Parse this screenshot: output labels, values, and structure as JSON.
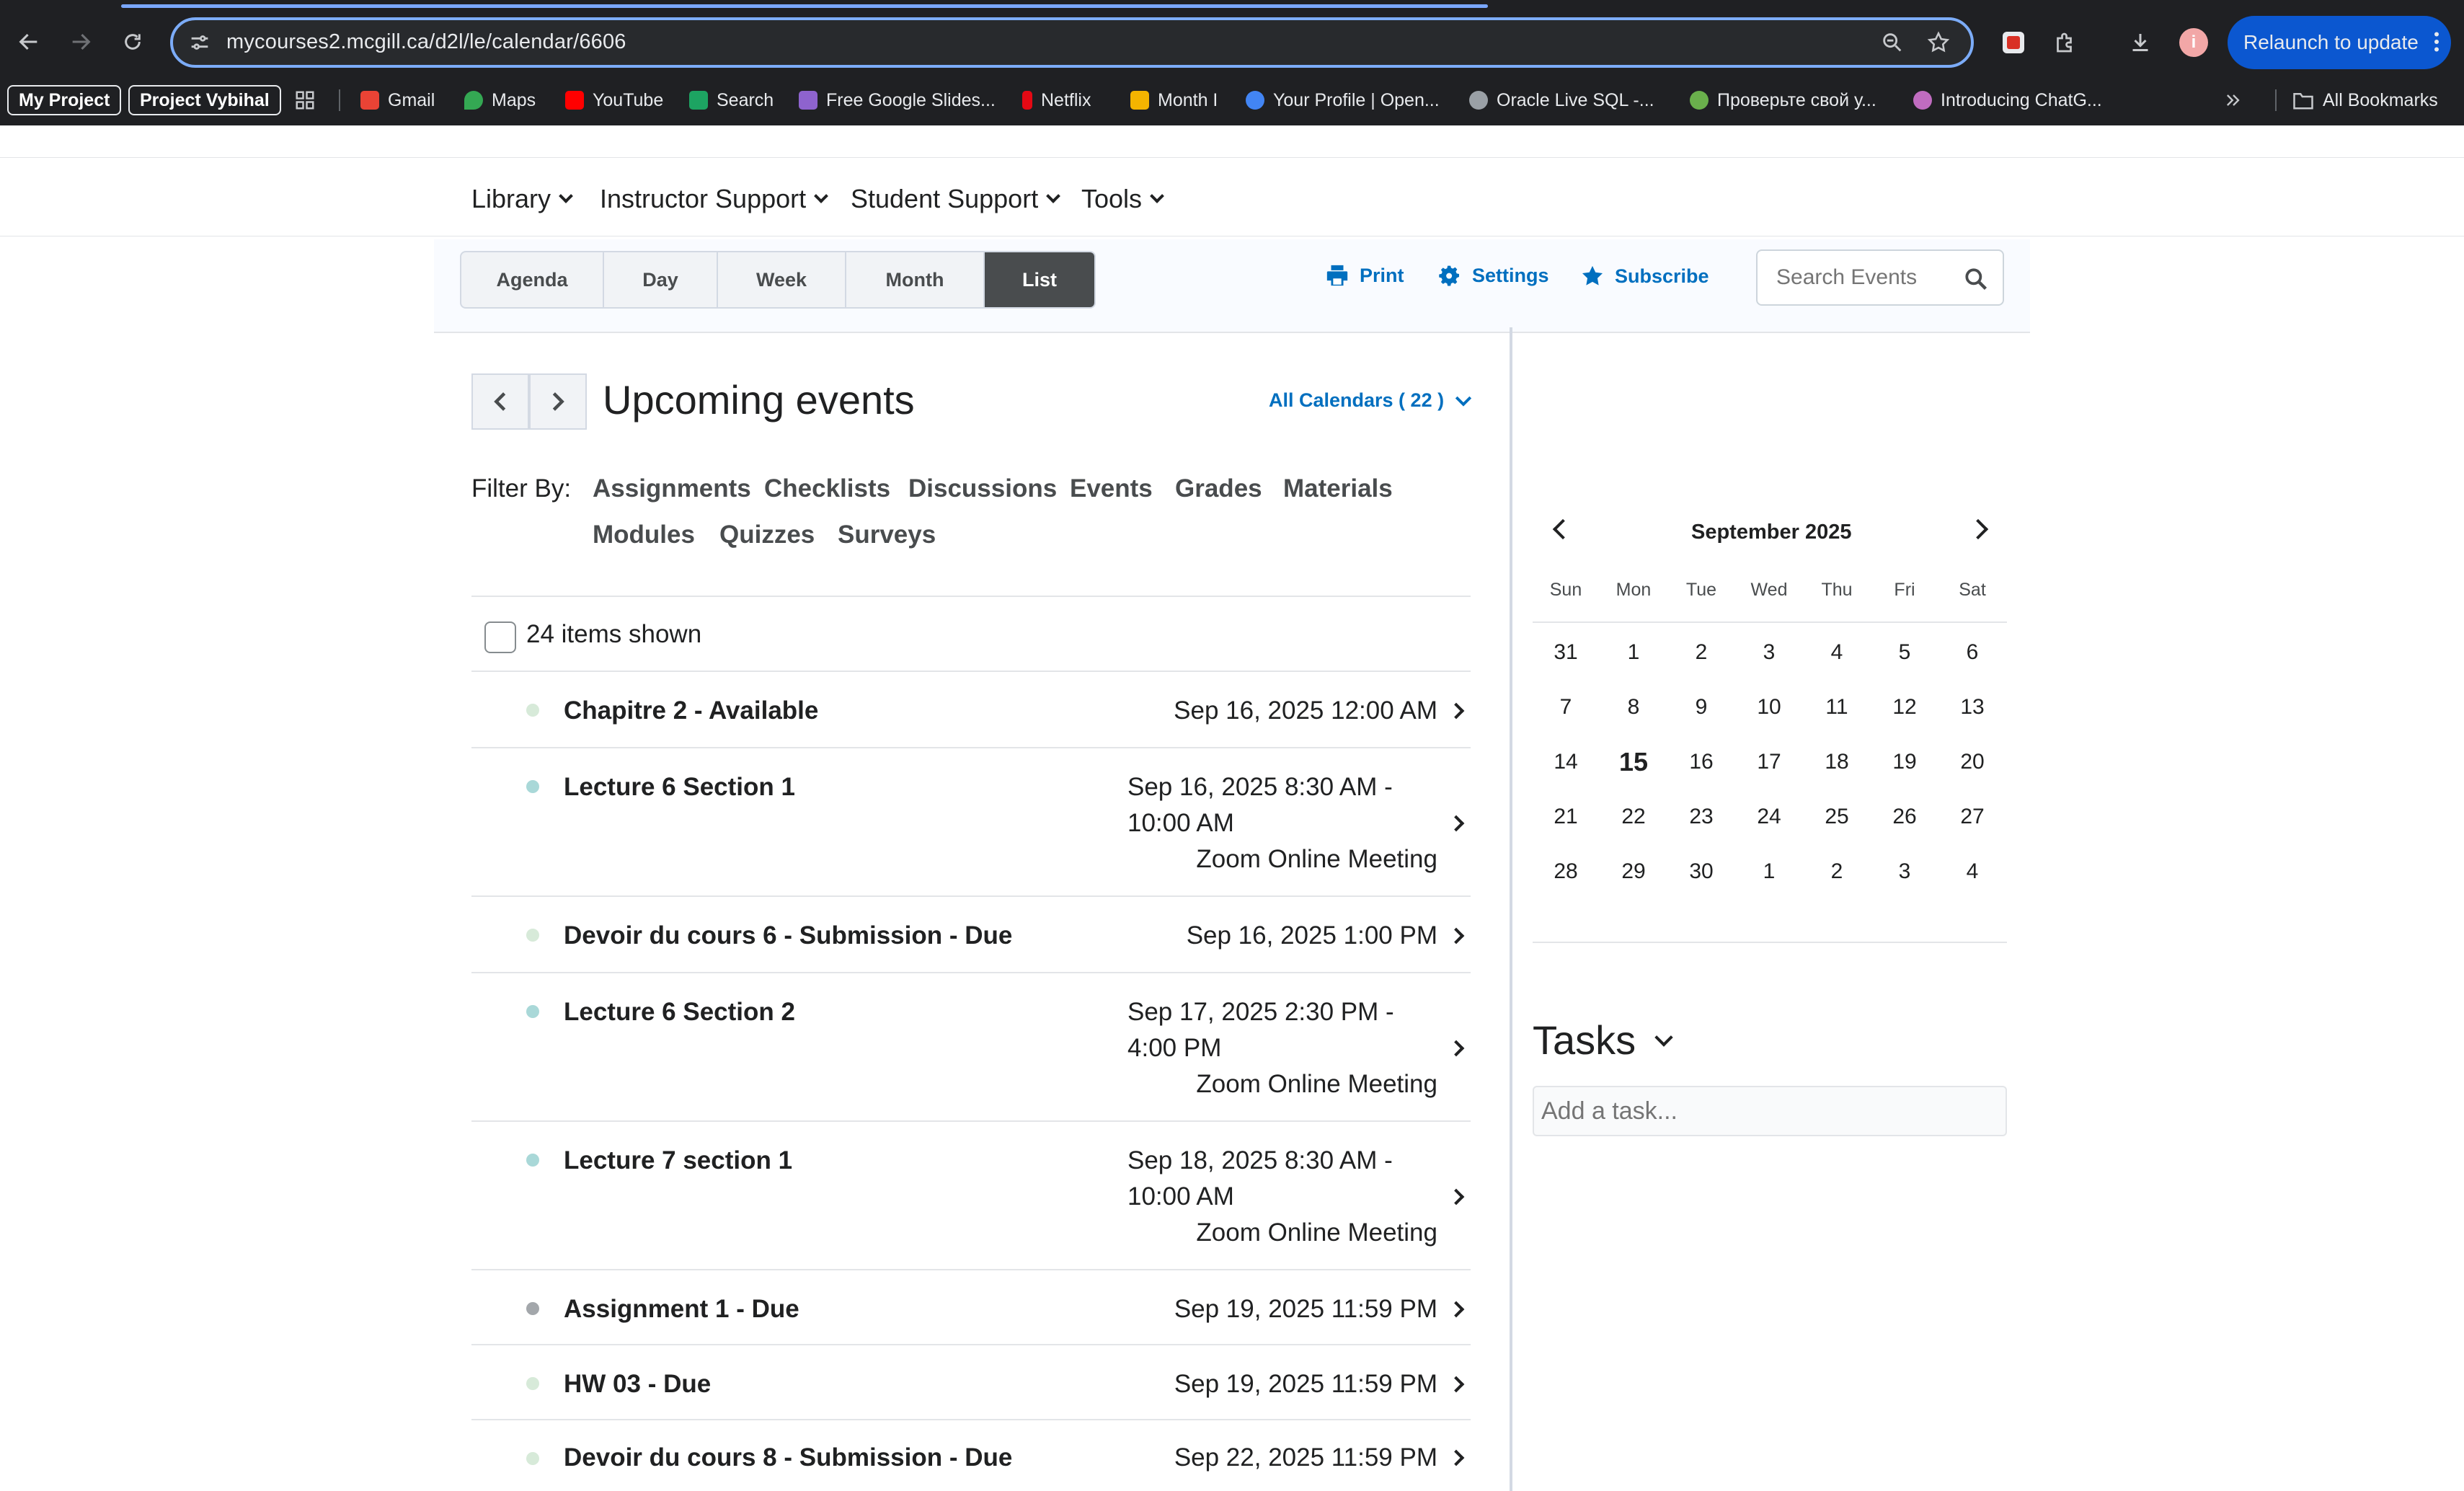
{
  "browser": {
    "url": "mycourses2.mcgill.ca/d2l/le/calendar/6606",
    "relaunch_label": "Relaunch to update",
    "profile_initial": "i",
    "bookmarks": [
      {
        "label": "My Project",
        "style": "pill"
      },
      {
        "label": "Project Vybihal",
        "style": "pill"
      },
      {
        "label": "Gmail",
        "color": "#ea4335"
      },
      {
        "label": "Maps",
        "color": "#34a853"
      },
      {
        "label": "YouTube",
        "color": "#ff0000"
      },
      {
        "label": "Search",
        "color": "#1da462"
      },
      {
        "label": "Free Google Slides...",
        "color": "#8e63ce"
      },
      {
        "label": "Netflix",
        "color": "#e50914"
      },
      {
        "label": "Month I",
        "color": "#f4b400"
      },
      {
        "label": "Your Profile | Open...",
        "color": "#4285f4"
      },
      {
        "label": "Oracle Live SQL -...",
        "color": "#9aa0a6"
      },
      {
        "label": "Проверьте свой у...",
        "color": "#6ab04c"
      },
      {
        "label": "Introducing ChatG...",
        "color": "#c06cc0"
      }
    ],
    "all_bookmarks_label": "All Bookmarks"
  },
  "nav": {
    "items": [
      "Library",
      "Instructor Support",
      "Student Support",
      "Tools"
    ]
  },
  "toolbar": {
    "views": [
      "Agenda",
      "Day",
      "Week",
      "Month",
      "List"
    ],
    "active_view": "List",
    "print_label": "Print",
    "settings_label": "Settings",
    "subscribe_label": "Subscribe",
    "search_placeholder": "Search Events"
  },
  "list": {
    "title": "Upcoming events",
    "calendars_label": "All Calendars ( 22 )",
    "filter_label": "Filter By:",
    "filters": [
      "Assignments",
      "Checklists",
      "Discussions",
      "Events",
      "Grades",
      "Materials",
      "Modules",
      "Quizzes",
      "Surveys"
    ],
    "items_shown": "24 items shown",
    "events": [
      {
        "name": "Chapitre 2 - Available",
        "time": "Sep 16, 2025 12:00 AM",
        "dot": "#d7ead9"
      },
      {
        "name": "Lecture 6 Section 1",
        "time_line1": "Sep 16, 2025 8:30 AM -",
        "time_line2": "10:00 AM",
        "location": "Zoom Online Meeting",
        "dot": "#a9d8d8"
      },
      {
        "name": "Devoir du cours 6 - Submission - Due",
        "time": "Sep 16, 2025 1:00 PM",
        "dot": "#d7ead9"
      },
      {
        "name": "Lecture 6 Section 2",
        "time_line1": "Sep 17, 2025 2:30 PM -",
        "time_line2": "4:00 PM",
        "location": "Zoom Online Meeting",
        "dot": "#a9d8d8"
      },
      {
        "name": "Lecture 7 section 1",
        "time_line1": "Sep 18, 2025 8:30 AM -",
        "time_line2": "10:00 AM",
        "location": "Zoom Online Meeting",
        "dot": "#a9d8d8"
      },
      {
        "name": "Assignment 1 - Due",
        "time": "Sep 19, 2025 11:59 PM",
        "dot": "#a3a7ab"
      },
      {
        "name": "HW 03 - Due",
        "time": "Sep 19, 2025 11:59 PM",
        "dot": "#d7ead9"
      },
      {
        "name": "Devoir du cours 8 - Submission - Due",
        "time": "Sep 22, 2025 11:59 PM",
        "dot": "#d7ead9"
      }
    ]
  },
  "calendar": {
    "month_label": "September 2025",
    "weekdays": [
      "Sun",
      "Mon",
      "Tue",
      "Wed",
      "Thu",
      "Fri",
      "Sat"
    ],
    "weeks": [
      [
        {
          "d": "31"
        },
        {
          "d": "1"
        },
        {
          "d": "2",
          "ev": true
        },
        {
          "d": "3",
          "ev": true
        },
        {
          "d": "4",
          "ev": true
        },
        {
          "d": "5",
          "ev": true
        },
        {
          "d": "6"
        }
      ],
      [
        {
          "d": "7"
        },
        {
          "d": "8",
          "ev": true
        },
        {
          "d": "9",
          "ev": true
        },
        {
          "d": "10",
          "ev": true
        },
        {
          "d": "11",
          "ev": true
        },
        {
          "d": "12",
          "ev": true
        },
        {
          "d": "13"
        }
      ],
      [
        {
          "d": "14"
        },
        {
          "d": "15",
          "ev": true,
          "today": true
        },
        {
          "d": "16",
          "ev": true
        },
        {
          "d": "17",
          "ev": true
        },
        {
          "d": "18",
          "ev": true
        },
        {
          "d": "19",
          "ev": true
        },
        {
          "d": "20"
        }
      ],
      [
        {
          "d": "21"
        },
        {
          "d": "22",
          "ev": true
        },
        {
          "d": "23"
        },
        {
          "d": "24",
          "ev": true
        },
        {
          "d": "25"
        },
        {
          "d": "26"
        },
        {
          "d": "27"
        }
      ],
      [
        {
          "d": "28"
        },
        {
          "d": "29",
          "ev": true
        },
        {
          "d": "30"
        },
        {
          "d": "1",
          "ev": true
        },
        {
          "d": "2"
        },
        {
          "d": "3"
        },
        {
          "d": "4"
        }
      ]
    ]
  },
  "tasks": {
    "title": "Tasks",
    "input_placeholder": "Add a task..."
  },
  "colors": {
    "accent": "#006fbf",
    "active_tab": "#494c4e",
    "chrome": "#1f2023",
    "relaunch": "#0b57d0"
  }
}
